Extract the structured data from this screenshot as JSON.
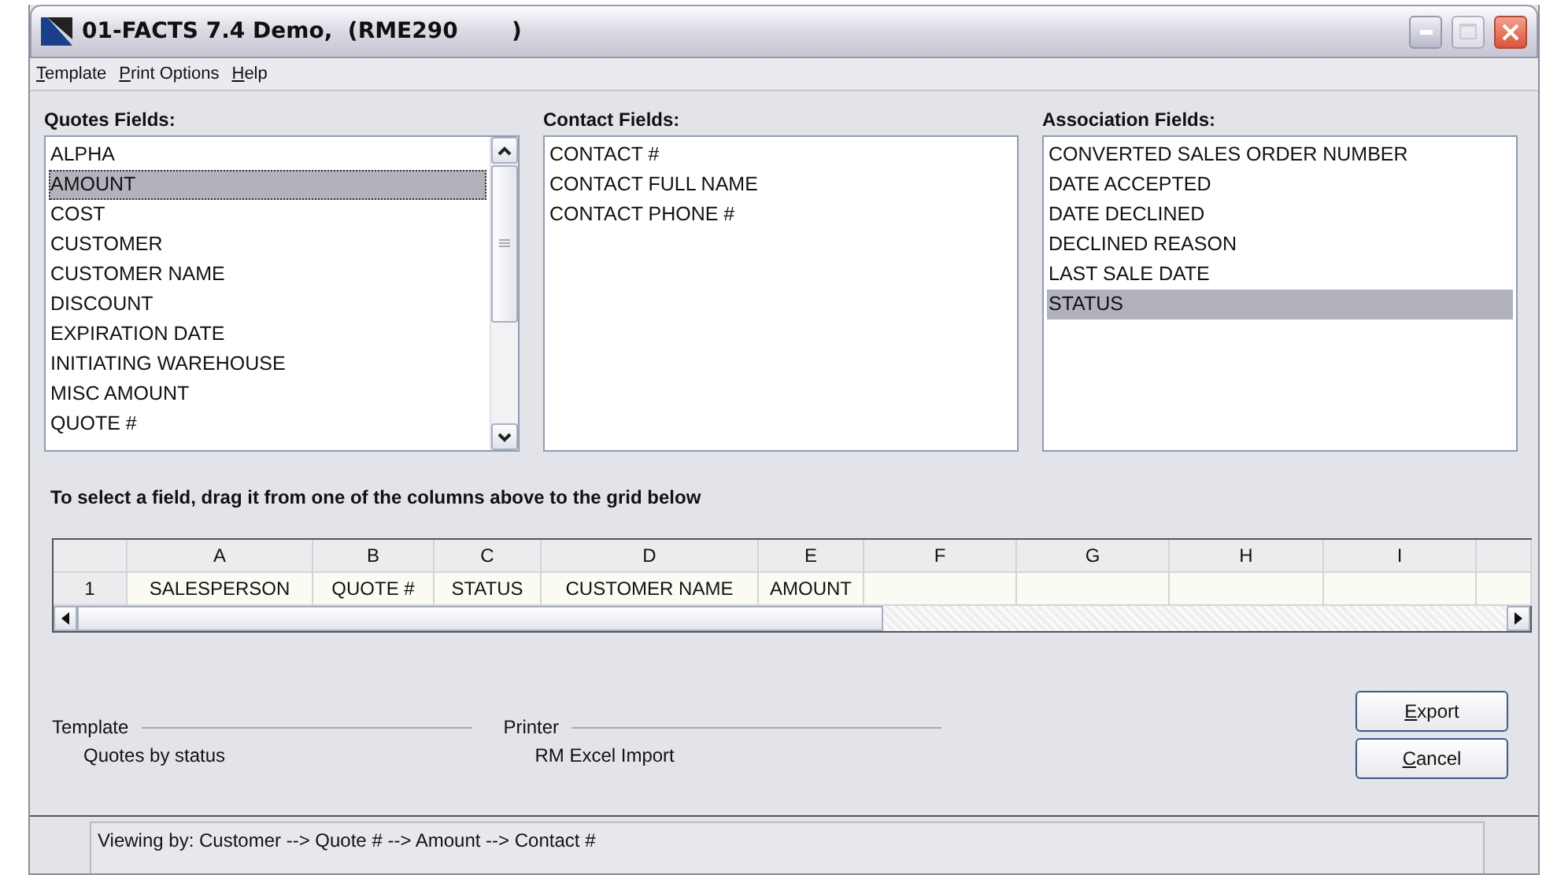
{
  "window": {
    "title": "01-FACTS 7.4 Demo,  (RME290       )",
    "maximize_disabled": true
  },
  "menu": [
    "Template",
    "Print Options",
    "Help"
  ],
  "lists": [
    {
      "label": "Quotes Fields:",
      "scrollbar": true,
      "items": [
        {
          "text": "ALPHA",
          "selected": false
        },
        {
          "text": "AMOUNT",
          "selected": true
        },
        {
          "text": "COST",
          "selected": false
        },
        {
          "text": "CUSTOMER",
          "selected": false
        },
        {
          "text": "CUSTOMER NAME",
          "selected": false
        },
        {
          "text": "DISCOUNT",
          "selected": false
        },
        {
          "text": "EXPIRATION DATE",
          "selected": false
        },
        {
          "text": "INITIATING WAREHOUSE",
          "selected": false
        },
        {
          "text": "MISC AMOUNT",
          "selected": false
        },
        {
          "text": "QUOTE #",
          "selected": false
        }
      ]
    },
    {
      "label": "Contact Fields:",
      "scrollbar": false,
      "items": [
        {
          "text": "CONTACT #",
          "selected": false
        },
        {
          "text": "CONTACT FULL NAME",
          "selected": false
        },
        {
          "text": "CONTACT PHONE #",
          "selected": false
        }
      ]
    },
    {
      "label": "Association Fields:",
      "scrollbar": false,
      "items": [
        {
          "text": "CONVERTED SALES ORDER NUMBER",
          "selected": false
        },
        {
          "text": "DATE ACCEPTED",
          "selected": false
        },
        {
          "text": "DATE DECLINED",
          "selected": false
        },
        {
          "text": "DECLINED REASON",
          "selected": false
        },
        {
          "text": "LAST SALE DATE",
          "selected": false
        },
        {
          "text": "STATUS",
          "selected": true
        }
      ]
    }
  ],
  "instruction": "To select a field, drag it from one of the columns above to the grid below",
  "grid": {
    "row_header": "1",
    "columns": [
      {
        "header": "A",
        "value": "SALESPERSON"
      },
      {
        "header": "B",
        "value": "QUOTE #"
      },
      {
        "header": "C",
        "value": "STATUS"
      },
      {
        "header": "D",
        "value": "CUSTOMER NAME"
      },
      {
        "header": "E",
        "value": "AMOUNT"
      },
      {
        "header": "F"
      },
      {
        "header": "G"
      },
      {
        "header": "H"
      },
      {
        "header": "I"
      },
      {}
    ]
  },
  "template": {
    "label": "Template",
    "value": "Quotes by status"
  },
  "printer": {
    "label": "Printer",
    "value": "RM Excel Import"
  },
  "buttons": [
    "Export",
    "Cancel"
  ],
  "status_bar": "Viewing by: Customer --> Quote # --> Amount --> Contact #"
}
